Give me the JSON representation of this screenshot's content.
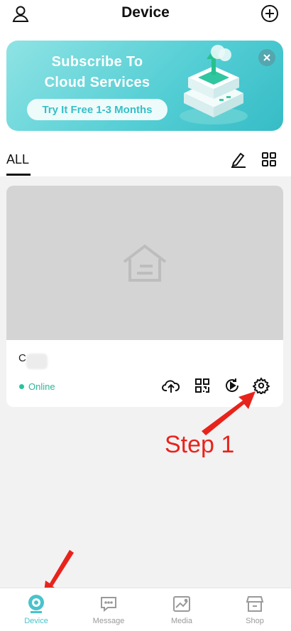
{
  "header": {
    "title": "Device"
  },
  "banner": {
    "line1": "Subscribe To",
    "line2": "Cloud Services",
    "cta": "Try It Free 1-3 Months"
  },
  "tabs": {
    "all": "ALL"
  },
  "device": {
    "name": "C",
    "status": "Online",
    "status_color": "#26c49b"
  },
  "annotation": {
    "step": "Step 1",
    "color": "#e8231c"
  },
  "nav": {
    "items": [
      {
        "label": "Device",
        "icon": "device-icon",
        "active": true
      },
      {
        "label": "Message",
        "icon": "message-icon",
        "active": false
      },
      {
        "label": "Media",
        "icon": "media-icon",
        "active": false
      },
      {
        "label": "Shop",
        "icon": "shop-icon",
        "active": false
      }
    ],
    "accent": "#48c3cc"
  }
}
